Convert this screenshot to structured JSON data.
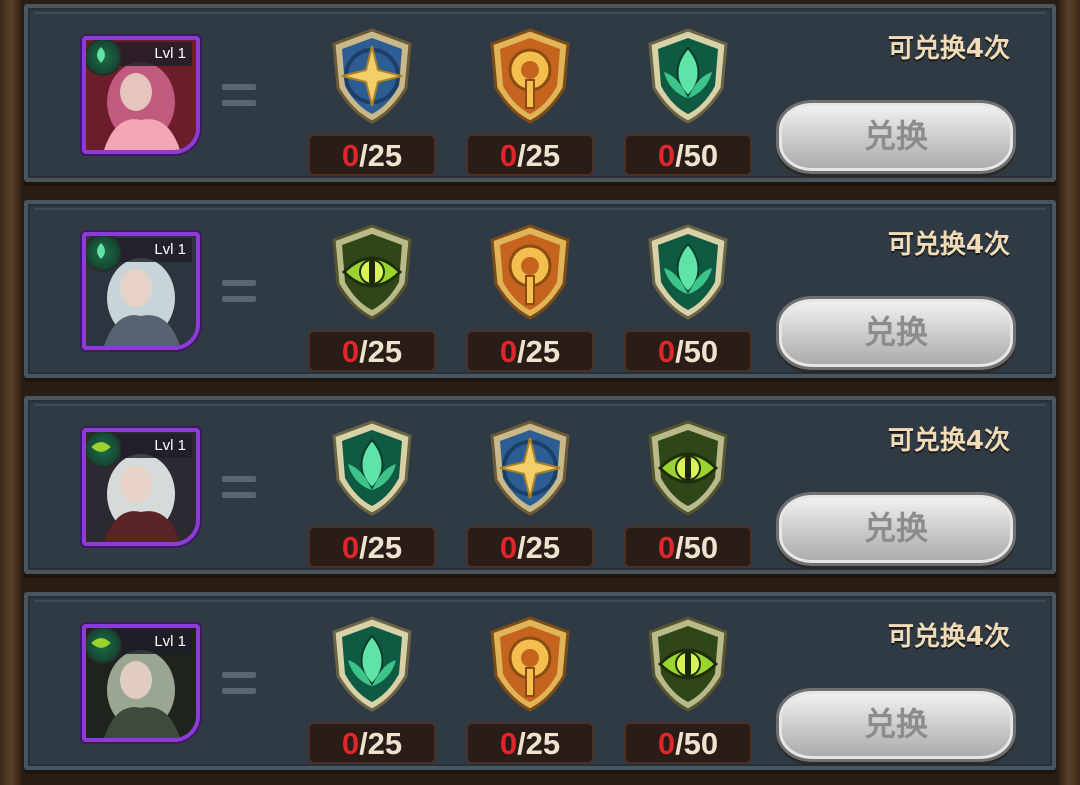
{
  "rows": [
    {
      "hero_level": "Lvl 1",
      "hero_class_icon": "lotus-class-icon",
      "portrait_palette": [
        "#c05a7e",
        "#f2a6b6",
        "#6b1e2a"
      ],
      "items": [
        {
          "emblem": "star-emblem",
          "have": "0",
          "need": "/25"
        },
        {
          "emblem": "sun-emblem",
          "have": "0",
          "need": "/25"
        },
        {
          "emblem": "lotus-emblem",
          "have": "0",
          "need": "/50"
        }
      ],
      "limit_text": "可兑换4次",
      "button_label": "兑换"
    },
    {
      "hero_level": "Lvl 1",
      "hero_class_icon": "lotus-class-icon",
      "portrait_palette": [
        "#c9d4d8",
        "#556470",
        "#2c3440"
      ],
      "items": [
        {
          "emblem": "eye-emblem",
          "have": "0",
          "need": "/25"
        },
        {
          "emblem": "sun-emblem",
          "have": "0",
          "need": "/25"
        },
        {
          "emblem": "lotus-emblem",
          "have": "0",
          "need": "/50"
        }
      ],
      "limit_text": "可兑换4次",
      "button_label": "兑换"
    },
    {
      "hero_level": "Lvl 1",
      "hero_class_icon": "eye-class-icon",
      "portrait_palette": [
        "#d6dadb",
        "#5a2426",
        "#2b2a33"
      ],
      "items": [
        {
          "emblem": "lotus-emblem",
          "have": "0",
          "need": "/25"
        },
        {
          "emblem": "star-emblem",
          "have": "0",
          "need": "/25"
        },
        {
          "emblem": "eye-emblem",
          "have": "0",
          "need": "/50"
        }
      ],
      "limit_text": "可兑换4次",
      "button_label": "兑换"
    },
    {
      "hero_level": "Lvl 1",
      "hero_class_icon": "eye-class-icon",
      "portrait_palette": [
        "#9aa592",
        "#3e4a3c",
        "#1e241c"
      ],
      "items": [
        {
          "emblem": "lotus-emblem",
          "have": "0",
          "need": "/25"
        },
        {
          "emblem": "sun-emblem",
          "have": "0",
          "need": "/25"
        },
        {
          "emblem": "eye-emblem",
          "have": "0",
          "need": "/50"
        }
      ],
      "limit_text": "可兑换4次",
      "button_label": "兑换"
    }
  ],
  "colors": {
    "panel": "#2f3a44",
    "portrait_border": "#8c3bd6",
    "count_have": "#e0262b",
    "count_need": "#efe3cf",
    "limit_text": "#f1dcb8",
    "button_disabled": "#c9c9c9"
  }
}
